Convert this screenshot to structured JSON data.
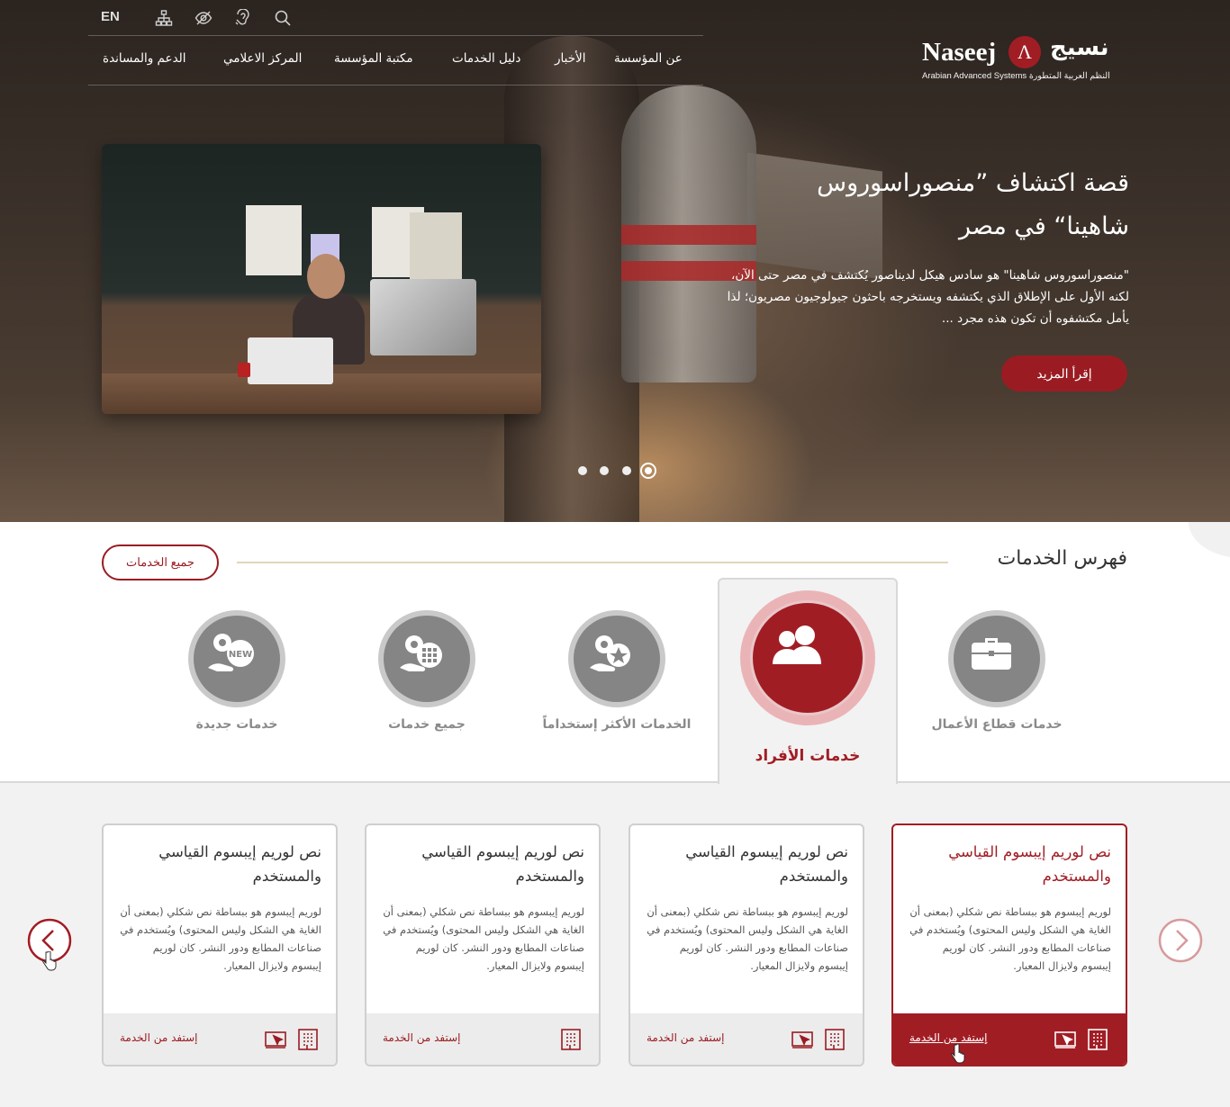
{
  "header": {
    "lang_switch": "EN",
    "tool_icons": [
      "search-icon",
      "accessibility-icon",
      "eye-icon",
      "sitemap-icon"
    ],
    "logo": {
      "latin": "Naseej",
      "arabic": "نسيج",
      "tagline": "Arabian Advanced Systems النظم العربية المتطورة"
    },
    "nav": [
      {
        "label": "عن المؤسسة"
      },
      {
        "label": "الأخبار"
      },
      {
        "label": "دليل الخدمات"
      },
      {
        "label": "مكتبة المؤسسة"
      },
      {
        "label": "المركز الاعلامي"
      },
      {
        "label": "الدعم والمساندة"
      }
    ]
  },
  "hero": {
    "title": "قصة اكتشاف ”منصوراسوروس شاهينا“ في مصر",
    "text": "\"منصوراسوروس شاهينا\" هو سادس هيكل لديناصور يُكتشف في مصر حتى الآن، لكنه الأول على الإطلاق الذي يكتشفه ويستخرجه باحثون جيولوجيون مصريون؛ لذا يأمل مكتشفوه أن تكون هذه مجرد ...",
    "read_more": "إقرأ المزيد",
    "slides": 4,
    "active_slide": 4
  },
  "services_index": {
    "title": "فهرس الخدمات",
    "all_services": "جميع الخدمات",
    "categories": [
      {
        "label": "خدمات قطاع الأعمال",
        "icon": "briefcase-icon"
      },
      {
        "label": "خدمات الأفراد",
        "icon": "people-icon",
        "active": true
      },
      {
        "label": "الخدمات الأكثر إستخداماً",
        "icon": "star-gear-icon"
      },
      {
        "label": "جميع خدمات",
        "icon": "grid-gear-icon"
      },
      {
        "label": "خدمات جديدة",
        "icon": "new-gear-icon"
      }
    ]
  },
  "cards": [
    {
      "title": "نص لوريم إيبسوم القياسي والمستخدم",
      "body": "لوريم إيبسوم هو ببساطة نص شكلي (بمعنى أن الغاية هي الشكل وليس المحتوى) ويُستخدم في صناعات المطابع ودور النشر. كان لوريم إيبسوم ولايزال المعيار.",
      "link": "إستفد من الخدمة",
      "active": true
    },
    {
      "title": "نص لوريم إيبسوم القياسي والمستخدم",
      "body": "لوريم إيبسوم هو ببساطة نص شكلي (بمعنى أن الغاية هي الشكل وليس المحتوى) ويُستخدم في صناعات المطابع ودور النشر. كان لوريم إيبسوم ولايزال المعيار.",
      "link": "إستفد من الخدمة"
    },
    {
      "title": "نص لوريم إيبسوم القياسي والمستخدم",
      "body": "لوريم إيبسوم هو ببساطة نص شكلي (بمعنى أن الغاية هي الشكل وليس المحتوى) ويُستخدم في صناعات المطابع ودور النشر. كان لوريم إيبسوم ولايزال المعيار.",
      "link": "إستفد من الخدمة"
    },
    {
      "title": "نص لوريم إيبسوم القياسي والمستخدم",
      "body": "لوريم إيبسوم هو ببساطة نص شكلي (بمعنى أن الغاية هي الشكل وليس المحتوى) ويُستخدم في صناعات المطابع ودور النشر. كان لوريم إيبسوم ولايزال المعيار.",
      "link": "إستفد من الخدمة"
    }
  ],
  "colors": {
    "brand": "#a11d24",
    "accent_line": "#e3d6b6",
    "inactive_icon": "#858585"
  }
}
